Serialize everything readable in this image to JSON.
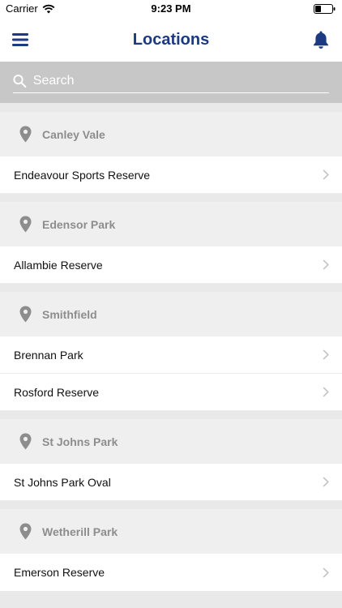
{
  "status": {
    "carrier": "Carrier",
    "time": "9:23 PM"
  },
  "nav": {
    "title": "Locations"
  },
  "search": {
    "placeholder": "Search"
  },
  "sections": [
    {
      "suburb": "Canley Vale",
      "venues": [
        "Endeavour Sports Reserve"
      ]
    },
    {
      "suburb": "Edensor Park",
      "venues": [
        "Allambie Reserve"
      ]
    },
    {
      "suburb": "Smithfield",
      "venues": [
        "Brennan Park",
        "Rosford Reserve"
      ]
    },
    {
      "suburb": "St Johns Park",
      "venues": [
        "St Johns Park Oval"
      ]
    },
    {
      "suburb": "Wetherill Park",
      "venues": [
        "Emerson Reserve"
      ]
    }
  ],
  "colors": {
    "title": "#1c3a82",
    "header_text": "#8d8d8d",
    "search_bg": "#c7c7c7"
  },
  "icons": {
    "menu": "hamburger-menu-icon",
    "bell": "bell-icon",
    "pin": "location-pin-icon",
    "chevron": "chevron-right-icon"
  }
}
